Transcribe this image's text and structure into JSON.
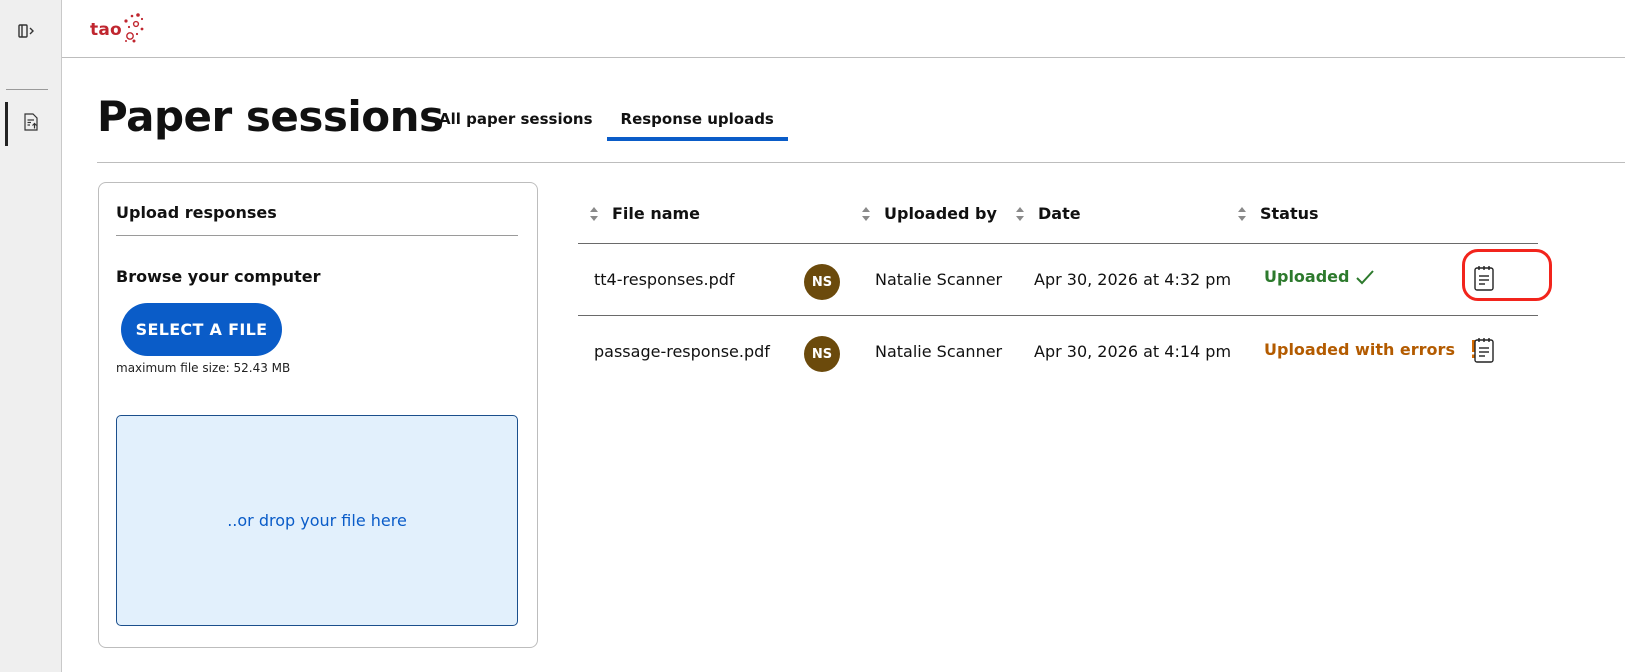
{
  "app": {
    "logo_text": "tao"
  },
  "sidebar": {
    "collapse_icon": "sidebar-collapse-icon",
    "items": [
      {
        "icon": "document-upload-icon",
        "active": true
      }
    ]
  },
  "header": {
    "title": "Paper sessions",
    "tabs": [
      {
        "label": "All paper sessions",
        "active": false
      },
      {
        "label": "Response uploads",
        "active": true
      }
    ]
  },
  "upload_panel": {
    "title": "Upload responses",
    "browse_label": "Browse your computer",
    "select_button": "SELECT A FILE",
    "max_size_text": "maximum file size: 52.43 MB",
    "dropzone_text": "..or drop your file here"
  },
  "table": {
    "columns": [
      "File name",
      "Uploaded by",
      "Date",
      "Status"
    ],
    "rows": [
      {
        "file_name": "tt4-responses.pdf",
        "avatar_initials": "NS",
        "uploaded_by": "Natalie Scanner",
        "date": "Apr 30, 2026 at 4:32 pm",
        "status": "Uploaded",
        "status_type": "success"
      },
      {
        "file_name": "passage-response.pdf",
        "avatar_initials": "NS",
        "uploaded_by": "Natalie Scanner",
        "date": "Apr 30, 2026 at 4:14 pm",
        "status": "Uploaded with errors",
        "status_type": "warning"
      }
    ]
  },
  "colors": {
    "primary": "#0a5cc8",
    "success": "#2d7a2d",
    "warning": "#b35b00",
    "avatar": "#6b4a0c",
    "highlight": "#f2241c",
    "brand": "#c0262f"
  }
}
